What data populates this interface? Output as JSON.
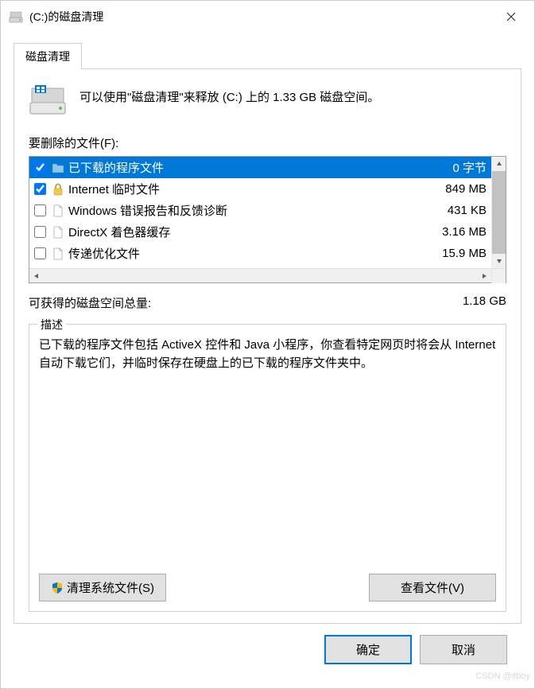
{
  "window": {
    "title": "(C:)的磁盘清理"
  },
  "tab": {
    "label": "磁盘清理"
  },
  "intro": {
    "text": "可以使用\"磁盘清理\"来释放  (C:) 上的 1.33 GB 磁盘空间。"
  },
  "filesSection": {
    "label": "要删除的文件(F):"
  },
  "fileList": [
    {
      "checked": true,
      "selected": true,
      "icon": "folder",
      "name": "已下载的程序文件",
      "size": "0 字节"
    },
    {
      "checked": true,
      "selected": false,
      "icon": "lock",
      "name": "Internet 临时文件",
      "size": "849 MB"
    },
    {
      "checked": false,
      "selected": false,
      "icon": "file",
      "name": "Windows 错误报告和反馈诊断",
      "size": "431 KB"
    },
    {
      "checked": false,
      "selected": false,
      "icon": "file",
      "name": "DirectX 着色器缓存",
      "size": "3.16 MB"
    },
    {
      "checked": false,
      "selected": false,
      "icon": "file",
      "name": "传递优化文件",
      "size": "15.9 MB"
    }
  ],
  "total": {
    "label": "可获得的磁盘空间总量:",
    "value": "1.18 GB"
  },
  "description": {
    "legend": "描述",
    "text": "已下载的程序文件包括 ActiveX 控件和 Java 小程序，你查看特定网页时将会从 Internet 自动下载它们，并临时保存在硬盘上的已下载的程序文件夹中。"
  },
  "buttons": {
    "cleanSystem": "清理系统文件(S)",
    "viewFiles": "查看文件(V)",
    "ok": "确定",
    "cancel": "取消"
  },
  "watermark": "CSDN @itboy"
}
